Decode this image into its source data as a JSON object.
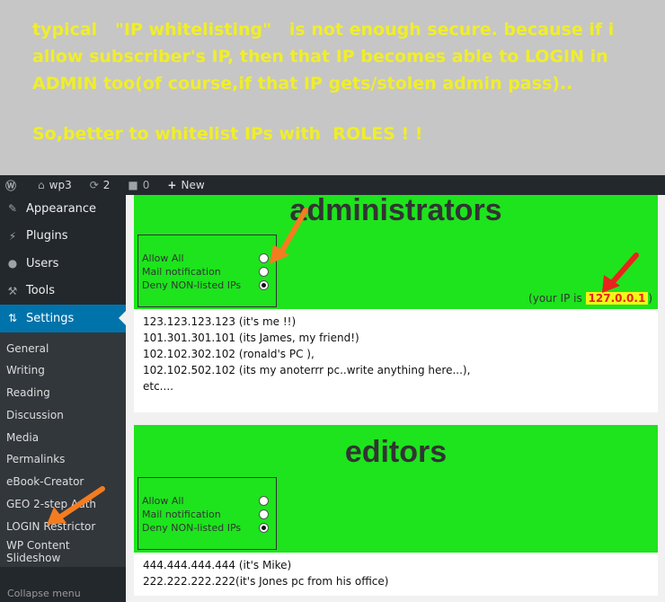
{
  "note": {
    "line1": "typical   \"IP whitelisting\"   is not enough secure. because if i allow subscriber's IP, then that IP becomes able to LOGIN in ADMIN too(of course,if that IP gets/stolen admin pass)..",
    "line2": "So,better to whitelist IPs with  ROLES ! !"
  },
  "adminbar": {
    "site": "wp3",
    "updates": "2",
    "comments": "0",
    "new": "New"
  },
  "sidebar": {
    "items": [
      {
        "label": "Appearance",
        "icon": "paintbrush-icon"
      },
      {
        "label": "Plugins",
        "icon": "plugin-icon"
      },
      {
        "label": "Users",
        "icon": "users-icon"
      },
      {
        "label": "Tools",
        "icon": "wrench-icon"
      },
      {
        "label": "Settings",
        "icon": "settings-icon"
      }
    ],
    "submenu": [
      "General",
      "Writing",
      "Reading",
      "Discussion",
      "Media",
      "Permalinks",
      "eBook-Creator",
      "GEO 2-step Auth",
      "LOGIN Restrictor",
      "WP Content Slideshow"
    ],
    "collapse": "Collapse menu"
  },
  "admins": {
    "title": "administrators",
    "options": [
      "Allow All",
      "Mail notification",
      "Deny NON-listed IPs"
    ],
    "ip_prefix": "(your IP is",
    "ip_value": "127.0.0.1",
    "ip_suffix": ")",
    "list": [
      "123.123.123.123 (it's me !!)",
      "101.301.301.101 (its James, my friend!)",
      " 102.102.302.102 (ronald's PC ),",
      " 102.102.502.102 (its my anoterrr pc..write anything here...),",
      " etc...."
    ]
  },
  "editors": {
    "title": "editors",
    "options": [
      "Allow All",
      "Mail notification",
      "Deny NON-listed IPs"
    ],
    "list": [
      "444.444.444.444 (it's Mike)",
      "222.222.222.222(it's Jones pc from his office)"
    ]
  },
  "colors": {
    "accent_green": "#1de41d",
    "note_yellow": "#f0ee2a",
    "arrow_orange": "#f47c20",
    "arrow_red": "#e8231b"
  }
}
